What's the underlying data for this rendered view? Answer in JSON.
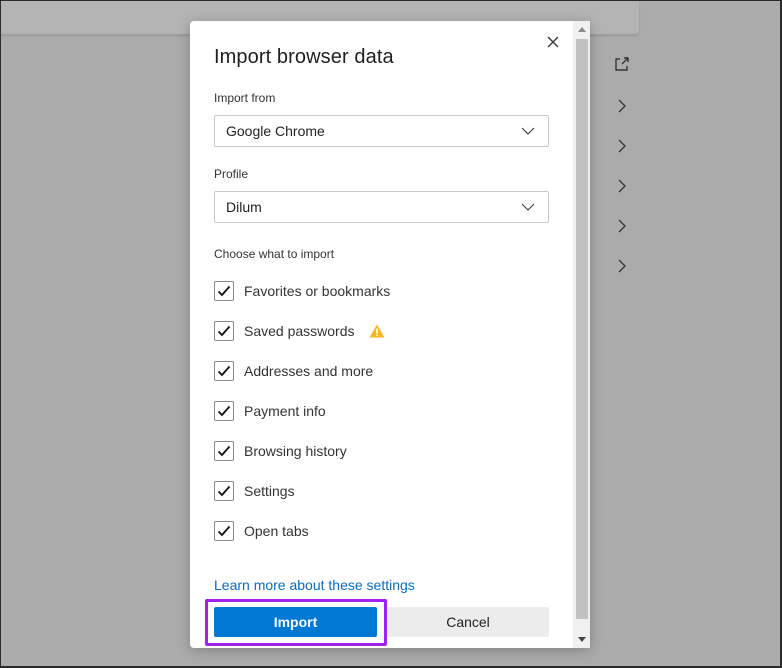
{
  "dialog": {
    "title": "Import browser data",
    "close_icon": "close-icon",
    "import_from": {
      "label": "Import from",
      "value": "Google Chrome"
    },
    "profile": {
      "label": "Profile",
      "value": "Dilum"
    },
    "choose_label": "Choose what to import",
    "items": [
      {
        "label": "Favorites or bookmarks",
        "checked": true,
        "warning": false
      },
      {
        "label": "Saved passwords",
        "checked": true,
        "warning": true
      },
      {
        "label": "Addresses and more",
        "checked": true,
        "warning": false
      },
      {
        "label": "Payment info",
        "checked": true,
        "warning": false
      },
      {
        "label": "Browsing history",
        "checked": true,
        "warning": false
      },
      {
        "label": "Settings",
        "checked": true,
        "warning": false
      },
      {
        "label": "Open tabs",
        "checked": true,
        "warning": false
      }
    ],
    "learn_more": "Learn more about these settings",
    "import_button": "Import",
    "cancel_button": "Cancel"
  },
  "background": {
    "side_icons": [
      "external-link-icon",
      "chevron-right-icon",
      "chevron-right-icon",
      "chevron-right-icon",
      "chevron-right-icon",
      "chevron-right-icon"
    ]
  },
  "colors": {
    "accent": "#0078d4",
    "link": "#0a6cc0",
    "highlight": "#a020f0",
    "warning": "#f9b61a"
  }
}
